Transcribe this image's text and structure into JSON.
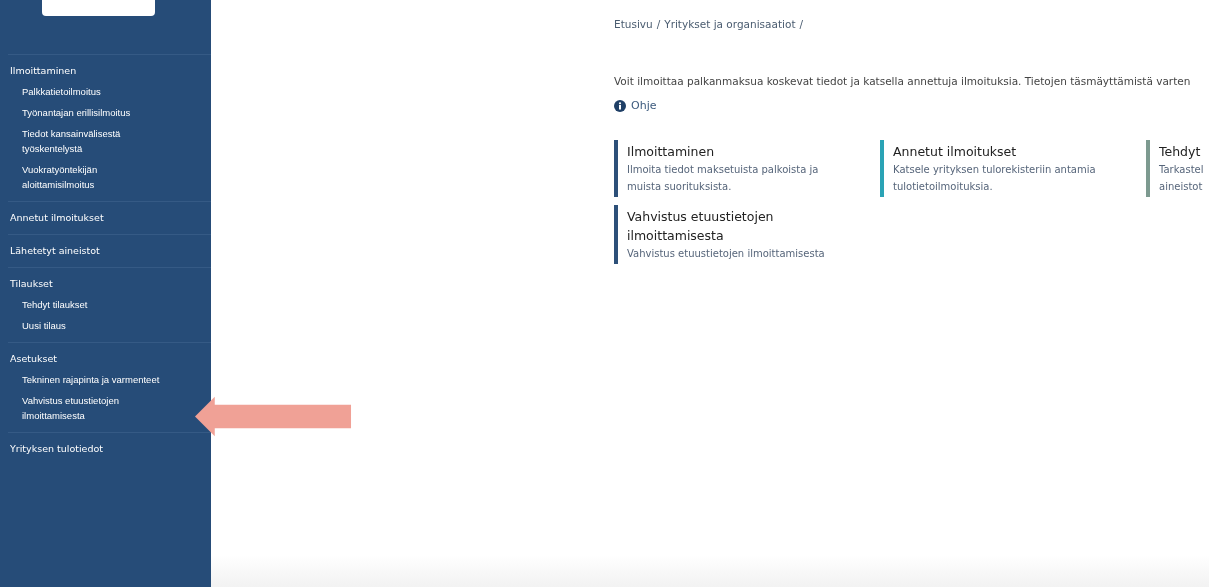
{
  "sidebar": {
    "groups": [
      {
        "label": "Ilmoittaminen",
        "children": [
          {
            "label": "Palkkatietoilmoitus"
          },
          {
            "label": "Työnantajan erillisilmoitus"
          },
          {
            "label": "Tiedot kansainvälisestä työskentelystä"
          },
          {
            "label": "Vuokratyöntekijän aloittamisilmoitus"
          }
        ]
      },
      {
        "label": "Annetut ilmoitukset"
      },
      {
        "label": "Lähetetyt aineistot"
      },
      {
        "label": "Tilaukset",
        "children": [
          {
            "label": "Tehdyt tilaukset"
          },
          {
            "label": "Uusi tilaus"
          }
        ]
      },
      {
        "label": "Asetukset",
        "children": [
          {
            "label": "Tekninen rajapinta ja varmenteet"
          },
          {
            "label": "Vahvistus etuustietojen ilmoittamisesta"
          }
        ]
      },
      {
        "label": "Yrityksen tulotiedot"
      }
    ]
  },
  "breadcrumb": [
    {
      "label": "Etusivu",
      "separator": "/"
    },
    {
      "label": "Yritykset ja organisaatiot",
      "separator": "/"
    }
  ],
  "intro": "Voit ilmoittaa palkanmaksua koskevat tiedot ja katsella annettuja ilmoituksia. Tietojen täsmäyttämistä varten",
  "help_link": "Ohje",
  "cards": [
    {
      "title": "Ilmoittaminen",
      "description": "Ilmoita tiedot maksetuista palkoista ja muista suorituksista.",
      "color": "#2d5079"
    },
    {
      "title": "Annetut ilmoitukset",
      "description": "Katsele yrityksen tulorekisteriin antamia tulotietoilmoituksia.",
      "color": "#2aa3b5"
    },
    {
      "title": "Tehdyt",
      "description": "Tarkastel aineistot",
      "color": "#7d9a90"
    },
    {
      "title": "Vahvistus etuustietojen ilmoittamisesta",
      "description": "Vahvistus etuustietojen ilmoittamisesta",
      "color": "#2d5079"
    }
  ]
}
